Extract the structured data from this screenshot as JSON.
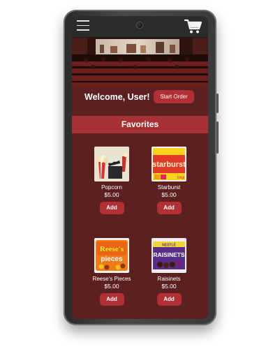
{
  "header": {
    "menu_icon": "hamburger-menu-icon",
    "cart_icon": "shopping-cart-icon"
  },
  "welcome": {
    "text": "Welcome, User!",
    "start_order_label": "Start Order"
  },
  "favorites": {
    "title": "Favorites",
    "items": [
      {
        "name": "Popcorn",
        "price": "$5.00",
        "add_label": "Add"
      },
      {
        "name": "Starburst",
        "price": "$5.00",
        "add_label": "Add"
      },
      {
        "name": "Reese's Pieces",
        "price": "$5.00",
        "add_label": "Add"
      },
      {
        "name": "Raisinets",
        "price": "$5.00",
        "add_label": "Add"
      }
    ]
  },
  "product_art": {
    "starburst_logo": "starburst",
    "starburst_tag": "Origi",
    "reeses_logo_1": "Reese's",
    "reeses_logo_2": "pieces",
    "raisinets_brand": "NESTLÉ",
    "raisinets_logo": "RAISINETS"
  },
  "colors": {
    "screen_bg": "#5c2020",
    "favorites_bar": "#a63236",
    "button": "#b22f34",
    "topbar": "#2c2c2c"
  }
}
